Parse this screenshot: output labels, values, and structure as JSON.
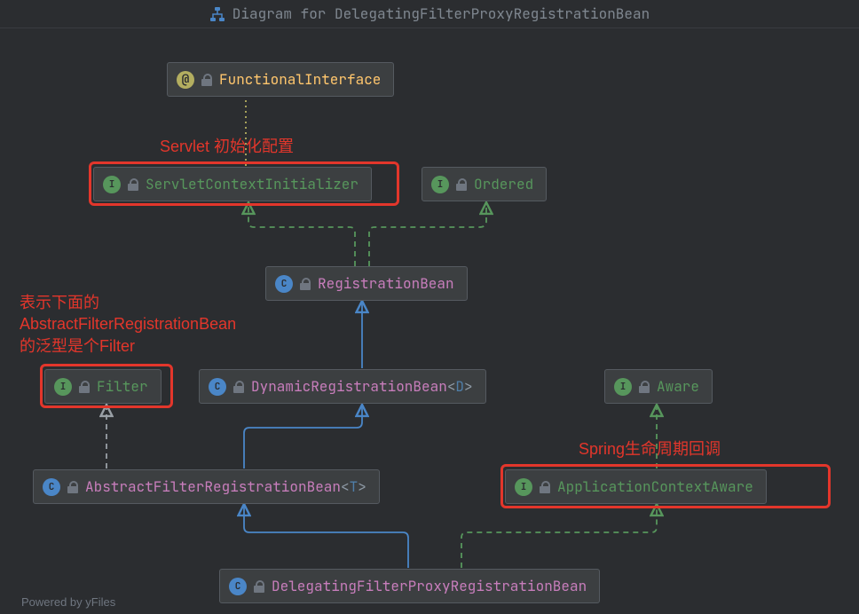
{
  "title": "Diagram for DelegatingFilterProxyRegistrationBean",
  "footer": "Powered by yFiles",
  "nodes": {
    "functionalInterface": {
      "kind": "@",
      "label": "FunctionalInterface"
    },
    "servletContextInitializer": {
      "kind": "I",
      "label": "ServletContextInitializer"
    },
    "ordered": {
      "kind": "I",
      "label": "Ordered"
    },
    "registrationBean": {
      "kind": "C",
      "label": "RegistrationBean"
    },
    "filter": {
      "kind": "I",
      "label": "Filter"
    },
    "dynamicRegistrationBeanPrefix": {
      "kind": "C",
      "label": "DynamicRegistrationBean"
    },
    "aware": {
      "kind": "I",
      "label": "Aware"
    },
    "abstractFilterRegBeanPrefix": {
      "kind": "C",
      "label": "AbstractFilterRegistrationBean"
    },
    "applicationContextAware": {
      "kind": "I",
      "label": "ApplicationContextAware"
    },
    "delegatingFilterProxyRegBean": {
      "kind": "C",
      "label": "DelegatingFilterProxyRegistrationBean"
    }
  },
  "generics": {
    "D": "D",
    "T": "T"
  },
  "annotations": {
    "servlet": "Servlet 初始化配置",
    "filterGeneric_l1": "表示下面的",
    "filterGeneric_l2": "AbstractFilterRegistrationBean",
    "filterGeneric_l3": "的泛型是个Filter",
    "springCallback": "Spring生命周期回调"
  }
}
